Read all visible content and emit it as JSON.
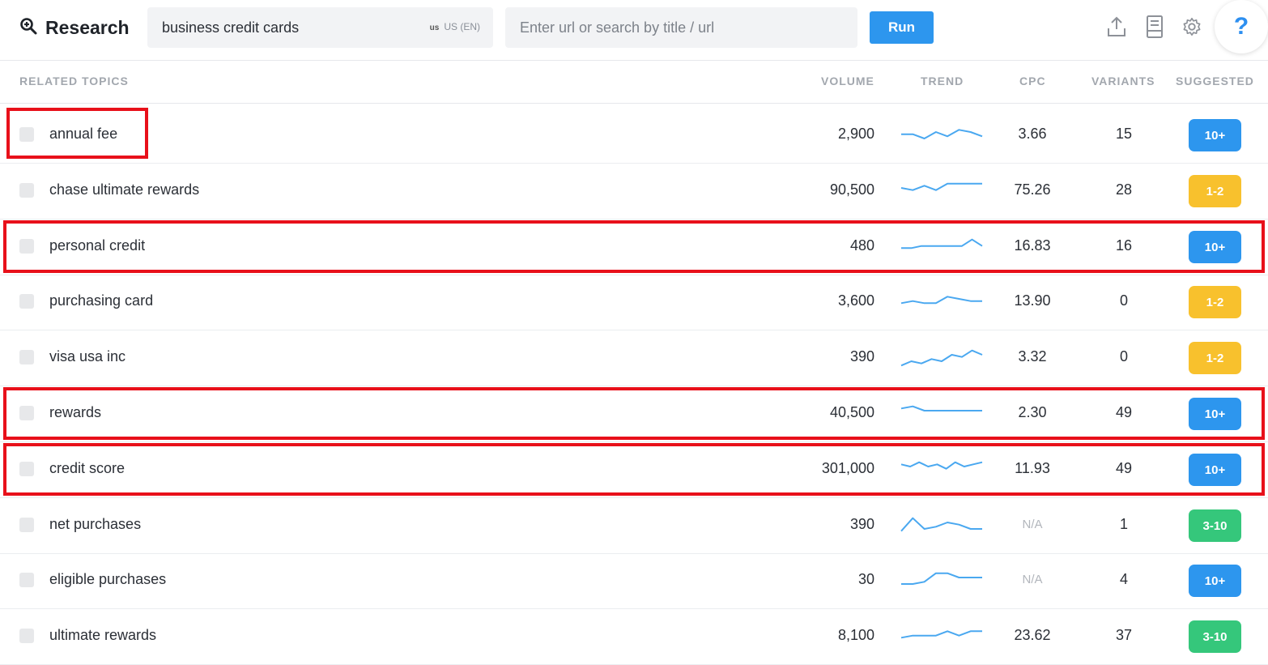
{
  "header": {
    "title": "Research",
    "search_value": "business credit cards",
    "locale_code": "us",
    "locale_label": "US (EN)",
    "url_placeholder": "Enter url or search by title / url",
    "run_label": "Run",
    "help_label": "?",
    "icons": [
      "search-icon",
      "upload-icon",
      "document-icon",
      "gear-icon",
      "help-icon"
    ]
  },
  "columns": {
    "topic": "RELATED TOPICS",
    "volume": "VOLUME",
    "trend": "TREND",
    "cpc": "CPC",
    "variants": "VARIANTS",
    "suggested": "SUGGESTED"
  },
  "badge_colors": {
    "10+": "#2d96ee",
    "1-2": "#f8c12d",
    "3-10": "#35c77b"
  },
  "highlight_color": "#e8101a",
  "rows": [
    {
      "keyword": "annual fee",
      "volume": "2,900",
      "cpc": "3.66",
      "variants": "15",
      "suggested": "10+",
      "trend": [
        4,
        4,
        6,
        3,
        5,
        2,
        3,
        5
      ],
      "highlighted": "keyword"
    },
    {
      "keyword": "chase ultimate rewards",
      "volume": "90,500",
      "cpc": "75.26",
      "variants": "28",
      "suggested": "1-2",
      "trend": [
        3,
        4,
        2,
        4,
        1,
        1,
        1,
        1
      ],
      "highlighted": ""
    },
    {
      "keyword": "personal credit",
      "volume": "480",
      "cpc": "16.83",
      "variants": "16",
      "suggested": "10+",
      "trend": [
        5,
        5,
        4,
        4,
        4,
        4,
        4,
        1,
        4
      ],
      "highlighted": "row"
    },
    {
      "keyword": "purchasing card",
      "volume": "3,600",
      "cpc": "13.90",
      "variants": "0",
      "suggested": "1-2",
      "trend": [
        5,
        4,
        5,
        5,
        2,
        3,
        4,
        4
      ],
      "highlighted": ""
    },
    {
      "keyword": "visa usa inc",
      "volume": "390",
      "cpc": "3.32",
      "variants": "0",
      "suggested": "1-2",
      "trend": [
        8,
        6,
        7,
        5,
        6,
        3,
        4,
        1,
        3
      ],
      "highlighted": ""
    },
    {
      "keyword": "rewards",
      "volume": "40,500",
      "cpc": "2.30",
      "variants": "49",
      "suggested": "10+",
      "trend": [
        2,
        1,
        3,
        3,
        3,
        3,
        3,
        3
      ],
      "highlighted": "row"
    },
    {
      "keyword": "credit score",
      "volume": "301,000",
      "cpc": "11.93",
      "variants": "49",
      "suggested": "10+",
      "trend": [
        2,
        3,
        1,
        3,
        2,
        4,
        1,
        3,
        2,
        1
      ],
      "highlighted": "row"
    },
    {
      "keyword": "net purchases",
      "volume": "390",
      "cpc": "N/A",
      "variants": "1",
      "suggested": "3-10",
      "trend": [
        7,
        1,
        6,
        5,
        3,
        4,
        6,
        6
      ],
      "highlighted": ""
    },
    {
      "keyword": "eligible purchases",
      "volume": "30",
      "cpc": "N/A",
      "variants": "4",
      "suggested": "10+",
      "trend": [
        6,
        6,
        5,
        1,
        1,
        3,
        3,
        3
      ],
      "highlighted": ""
    },
    {
      "keyword": "ultimate rewards",
      "volume": "8,100",
      "cpc": "23.62",
      "variants": "37",
      "suggested": "3-10",
      "trend": [
        5,
        4,
        4,
        4,
        2,
        4,
        2,
        2
      ],
      "highlighted": ""
    }
  ]
}
